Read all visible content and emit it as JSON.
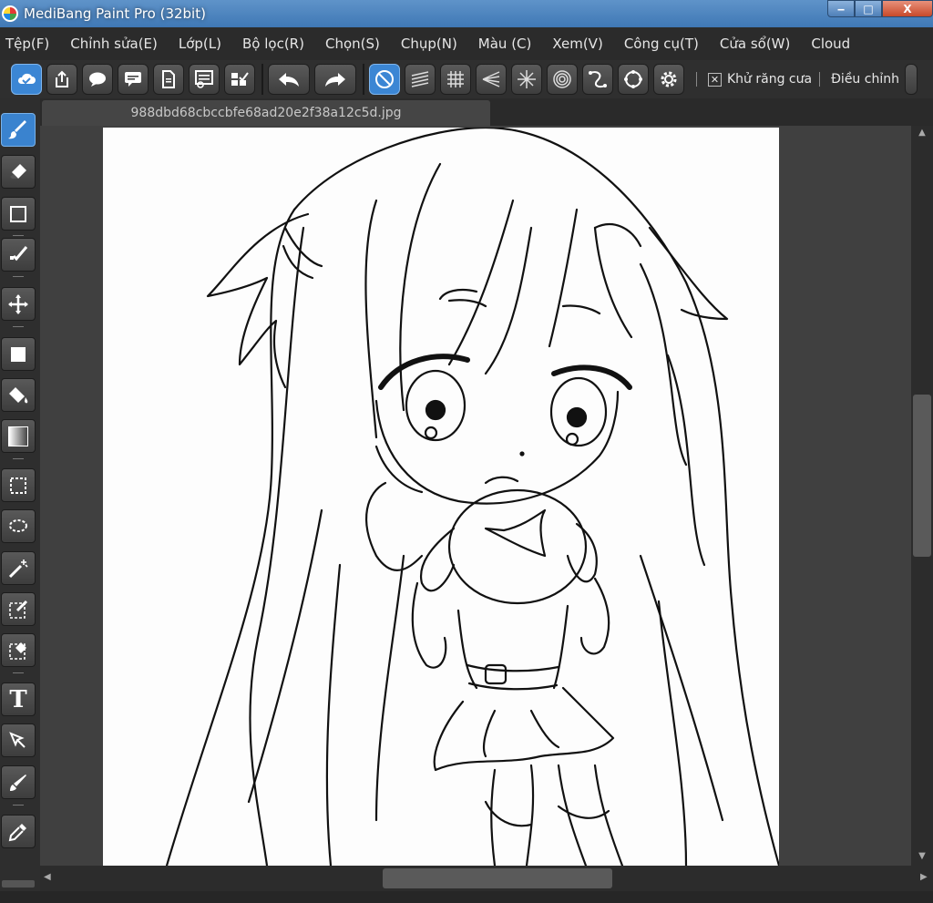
{
  "window": {
    "title": "MediBang Paint Pro (32bit)",
    "controls": {
      "minimize": "‒",
      "maximize": "□",
      "close": "X"
    }
  },
  "menu": [
    "Tệp(F)",
    "Chỉnh sửa(E)",
    "Lớp(L)",
    "Bộ lọc(R)",
    "Chọn(S)",
    "Chụp(N)",
    "Màu (C)",
    "Xem(V)",
    "Công cụ(T)",
    "Cửa sổ(W)",
    "Cloud"
  ],
  "toolbar": {
    "icons": [
      "cloud-save-icon",
      "share-icon",
      "speech-bubble-icon",
      "comment-icon",
      "document-icon",
      "list-settings-icon",
      "checklist-icon",
      "undo-icon",
      "redo-icon",
      "snap-off-icon",
      "parallel-snap-icon",
      "grid-snap-icon",
      "perspective-snap-icon",
      "radial-snap-icon",
      "concentric-snap-icon",
      "curve-snap-icon",
      "circle-snap-icon",
      "settings-gear-icon"
    ],
    "antialias_label": "Khử răng cưa",
    "antialias_checked": true,
    "adjust_label": "Điều chỉnh"
  },
  "document_tab": {
    "filename": "988dbd68cbccbfe68ad20e2f38a12c5d.jpg"
  },
  "left_tools": [
    "brush-tool-icon",
    "eraser-tool-icon",
    "rectangle-outline-tool-icon",
    "dot-tool-icon",
    "move-tool-icon",
    "fill-rectangle-tool-icon",
    "bucket-fill-tool-icon",
    "gradient-tool-icon",
    "select-rectangle-tool-icon",
    "lasso-select-tool-icon",
    "magic-wand-tool-icon",
    "select-pen-tool-icon",
    "select-eraser-tool-icon",
    "text-tool-icon",
    "operation-tool-icon",
    "blur-tool-icon",
    "eyedropper-tool-icon"
  ],
  "status": {
    "text": ""
  },
  "scroll": {
    "vertical_position": 0.45,
    "horizontal_position": 0.42
  },
  "colors": {
    "accent": "#3b86d4",
    "titlebar": "#4a82bd",
    "panel": "#2f2f2f",
    "canvas": "#fdfdfd"
  }
}
